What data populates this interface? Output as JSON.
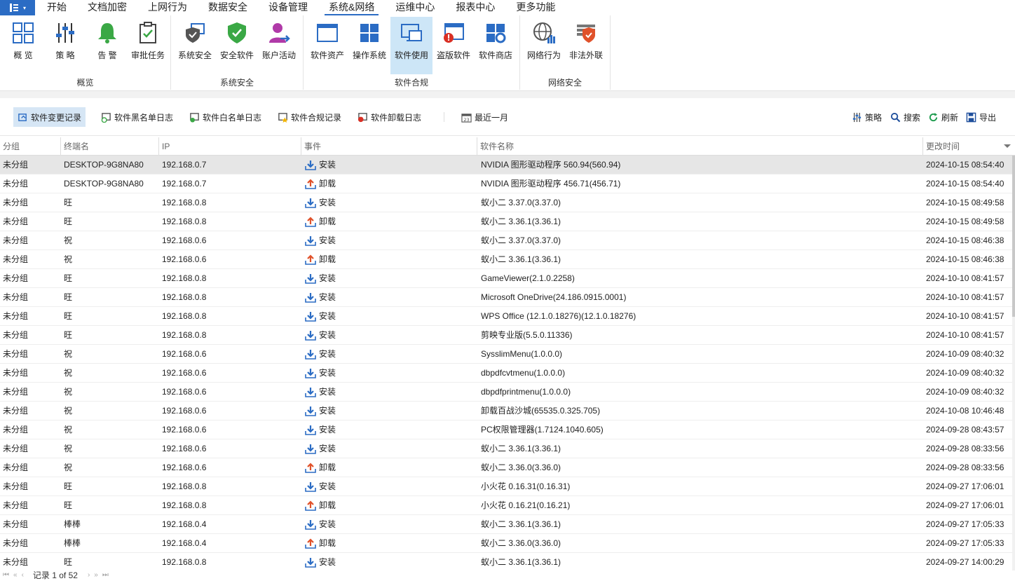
{
  "menubar": {
    "app_icon": "menu-icon",
    "items": [
      "开始",
      "文档加密",
      "上网行为",
      "数据安全",
      "设备管理",
      "系统&网络",
      "运维中心",
      "报表中心",
      "更多功能"
    ],
    "active_index": 5
  },
  "ribbon": {
    "groups": [
      {
        "label": "概览",
        "buttons": [
          "概 览",
          "策 略",
          "告 警",
          "审批任务"
        ]
      },
      {
        "label": "系统安全",
        "buttons": [
          "系统安全",
          "安全软件",
          "账户活动"
        ]
      },
      {
        "label": "软件合规",
        "buttons": [
          "软件资产",
          "操作系统",
          "软件使用",
          "盗版软件",
          "软件商店"
        ]
      },
      {
        "label": "网络安全",
        "buttons": [
          "网络行为",
          "非法外联"
        ]
      }
    ],
    "selected_button": "软件使用"
  },
  "toolbar": {
    "tabs": [
      "软件变更记录",
      "软件黑名单日志",
      "软件白名单日志",
      "软件合规记录",
      "软件卸载日志"
    ],
    "date_filter": "最近一月",
    "actions": [
      "策略",
      "搜索",
      "刷新",
      "导出"
    ]
  },
  "table": {
    "columns": [
      "分组",
      "终端名",
      "IP",
      "事件",
      "软件名称",
      "更改时间"
    ],
    "rows": [
      [
        "未分组",
        "DESKTOP-9G8NA80",
        "192.168.0.7",
        "安装",
        "NVIDIA 图形驱动程序 560.94(560.94)",
        "2024-10-15 08:54:40"
      ],
      [
        "未分组",
        "DESKTOP-9G8NA80",
        "192.168.0.7",
        "卸载",
        "NVIDIA 图形驱动程序 456.71(456.71)",
        "2024-10-15 08:54:40"
      ],
      [
        "未分组",
        "旺",
        "192.168.0.8",
        "安装",
        "蚁小二 3.37.0(3.37.0)",
        "2024-10-15 08:49:58"
      ],
      [
        "未分组",
        "旺",
        "192.168.0.8",
        "卸载",
        "蚁小二 3.36.1(3.36.1)",
        "2024-10-15 08:49:58"
      ],
      [
        "未分组",
        "祝",
        "192.168.0.6",
        "安装",
        "蚁小二 3.37.0(3.37.0)",
        "2024-10-15 08:46:38"
      ],
      [
        "未分组",
        "祝",
        "192.168.0.6",
        "卸载",
        "蚁小二 3.36.1(3.36.1)",
        "2024-10-15 08:46:38"
      ],
      [
        "未分组",
        "旺",
        "192.168.0.8",
        "安装",
        "GameViewer(2.1.0.2258)",
        "2024-10-10 08:41:57"
      ],
      [
        "未分组",
        "旺",
        "192.168.0.8",
        "安装",
        "Microsoft OneDrive(24.186.0915.0001)",
        "2024-10-10 08:41:57"
      ],
      [
        "未分组",
        "旺",
        "192.168.0.8",
        "安装",
        "WPS Office (12.1.0.18276)(12.1.0.18276)",
        "2024-10-10 08:41:57"
      ],
      [
        "未分组",
        "旺",
        "192.168.0.8",
        "安装",
        "剪映专业版(5.5.0.11336)",
        "2024-10-10 08:41:57"
      ],
      [
        "未分组",
        "祝",
        "192.168.0.6",
        "安装",
        "SysslimMenu(1.0.0.0)",
        "2024-10-09 08:40:32"
      ],
      [
        "未分组",
        "祝",
        "192.168.0.6",
        "安装",
        "dbpdfcvtmenu(1.0.0.0)",
        "2024-10-09 08:40:32"
      ],
      [
        "未分组",
        "祝",
        "192.168.0.6",
        "安装",
        "dbpdfprintmenu(1.0.0.0)",
        "2024-10-09 08:40:32"
      ],
      [
        "未分组",
        "祝",
        "192.168.0.6",
        "安装",
        "卸载百战沙城(65535.0.325.705)",
        "2024-10-08 10:46:48"
      ],
      [
        "未分组",
        "祝",
        "192.168.0.6",
        "安装",
        "PC权限管理器(1.7124.1040.605)",
        "2024-09-28 08:43:57"
      ],
      [
        "未分组",
        "祝",
        "192.168.0.6",
        "安装",
        "蚁小二 3.36.1(3.36.1)",
        "2024-09-28 08:33:56"
      ],
      [
        "未分组",
        "祝",
        "192.168.0.6",
        "卸载",
        "蚁小二 3.36.0(3.36.0)",
        "2024-09-28 08:33:56"
      ],
      [
        "未分组",
        "旺",
        "192.168.0.8",
        "安装",
        "小火花 0.16.31(0.16.31)",
        "2024-09-27 17:06:01"
      ],
      [
        "未分组",
        "旺",
        "192.168.0.8",
        "卸载",
        "小火花 0.16.21(0.16.21)",
        "2024-09-27 17:06:01"
      ],
      [
        "未分组",
        "棒棒",
        "192.168.0.4",
        "安装",
        "蚁小二 3.36.1(3.36.1)",
        "2024-09-27 17:05:33"
      ],
      [
        "未分组",
        "棒棒",
        "192.168.0.4",
        "卸载",
        "蚁小二 3.36.0(3.36.0)",
        "2024-09-27 17:05:33"
      ],
      [
        "未分组",
        "旺",
        "192.168.0.8",
        "安装",
        "蚁小二 3.36.1(3.36.1)",
        "2024-09-27 14:00:29"
      ]
    ]
  },
  "pager": {
    "text": "记录 1 of 52"
  },
  "colors": {
    "accent": "#2b6cc4",
    "install": "#2b6cc4",
    "uninstall": "#e0522b",
    "selected": "#cde6f7"
  }
}
